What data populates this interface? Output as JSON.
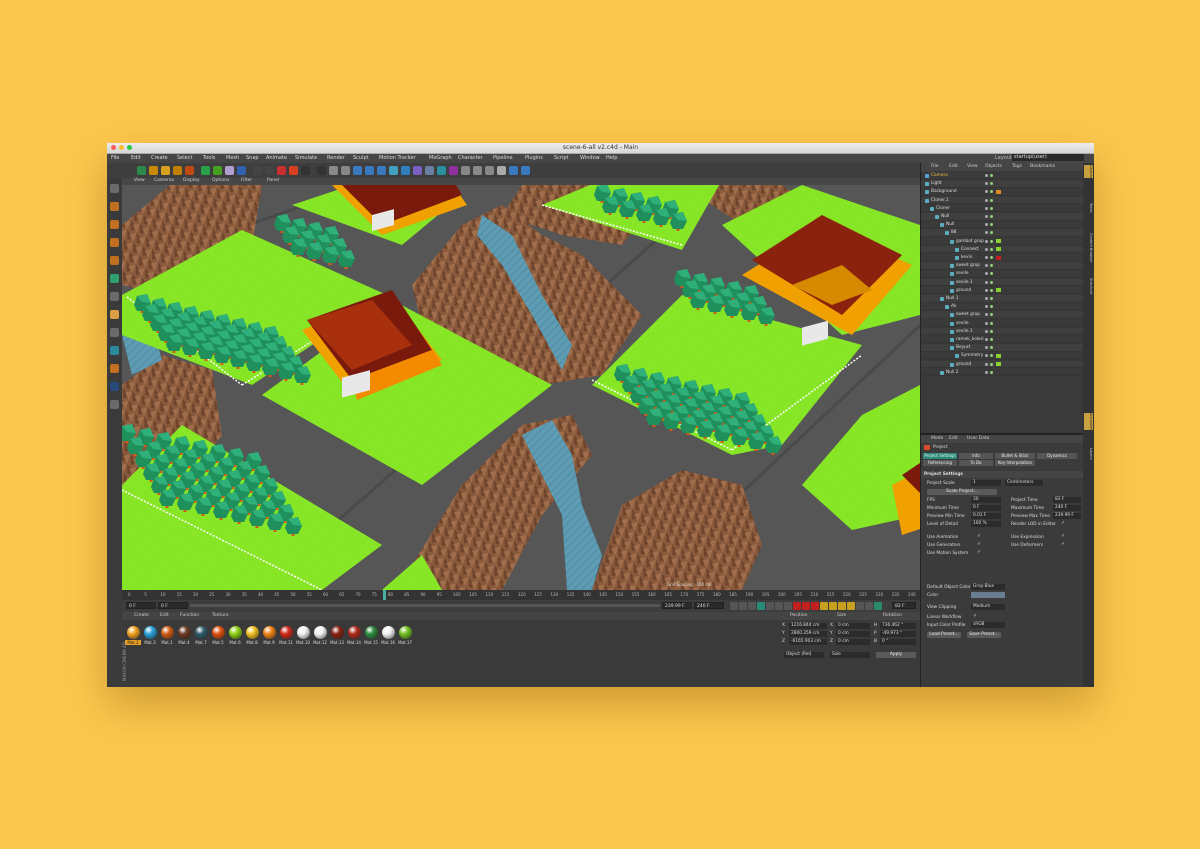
{
  "window": {
    "title": "scene-6-all v2.c4d - Main"
  },
  "menu": [
    "File",
    "Edit",
    "Create",
    "Select",
    "Tools",
    "Mesh",
    "Snap",
    "Animate",
    "Simulate",
    "Render",
    "Sculpt",
    "Motion Tracker",
    "MoGraph",
    "Character",
    "Pipeline",
    "Plugins",
    "Script",
    "Window",
    "Help"
  ],
  "layout": {
    "label": "Layout:",
    "value": "startup(user)"
  },
  "viewport": {
    "menu": [
      "View",
      "Cameras",
      "Display",
      "Options",
      "Filter",
      "Panel"
    ],
    "grid_spacing": "Grid Spacing : 100 cm",
    "perspective_label": "Perspective"
  },
  "timeline": {
    "ticks": [
      "0",
      "5",
      "10",
      "15",
      "20",
      "25",
      "30",
      "35",
      "40",
      "45",
      "50",
      "55",
      "60",
      "65",
      "70",
      "75",
      "80",
      "85",
      "90",
      "95",
      "100",
      "105",
      "110",
      "115",
      "120",
      "125",
      "130",
      "135",
      "140",
      "145",
      "150",
      "155",
      "160",
      "165",
      "170",
      "175",
      "180",
      "185",
      "190",
      "195",
      "200",
      "205",
      "210",
      "215",
      "220",
      "225",
      "230",
      "235",
      "240"
    ],
    "current_frame": "82 F"
  },
  "transport": {
    "start": "0 F",
    "field2": "0 F",
    "end_field": "239.99 F",
    "max": "240 F"
  },
  "materials": {
    "menu": [
      "Create",
      "Edit",
      "Function",
      "Texture"
    ],
    "items": [
      {
        "label": "Mat.2",
        "color": "#f0a020"
      },
      {
        "label": "Mat.3",
        "color": "#2aa0d8"
      },
      {
        "label": "Mat.1",
        "color": "#d05a10"
      },
      {
        "label": "Mat.4",
        "color": "#6b3a20"
      },
      {
        "label": "Mat.7",
        "color": "#2f5a6a"
      },
      {
        "label": "Mat.5",
        "color": "#e05010"
      },
      {
        "label": "Mat.6",
        "color": "#8ad010"
      },
      {
        "label": "Mat.8",
        "color": "#f0c020"
      },
      {
        "label": "Mat.9",
        "color": "#f08010"
      },
      {
        "label": "Mat.11",
        "color": "#d02818"
      },
      {
        "label": "Mat.10",
        "color": "#f0f0f0"
      },
      {
        "label": "Mat.12",
        "color": "#f4f4f4"
      },
      {
        "label": "Mat.13",
        "color": "#8a2010"
      },
      {
        "label": "Mat.14",
        "color": "#b02a18"
      },
      {
        "label": "Mat.15",
        "color": "#2a8a3a"
      },
      {
        "label": "Mat.16",
        "color": "#f0f0f0"
      },
      {
        "label": "Mat.17",
        "color": "#70c020"
      }
    ]
  },
  "coords": {
    "headers": [
      "Position",
      "Size",
      "Rotation"
    ],
    "rows": [
      {
        "axis": "X",
        "pos": "1216.844 cm",
        "size_axis": "X",
        "size": "0 cm",
        "rot_axis": "H",
        "rot": "736.462 °"
      },
      {
        "axis": "Y",
        "pos": "2800.359 cm",
        "size_axis": "Y",
        "size": "0 cm",
        "rot_axis": "P",
        "rot": "-49.973 °"
      },
      {
        "axis": "Z",
        "pos": "-6165.903 cm",
        "size_axis": "Z",
        "size": "0 cm",
        "rot_axis": "B",
        "rot": "0 °"
      }
    ],
    "mode_object": "Object (Rel)",
    "mode_size": "Size",
    "apply": "Apply"
  },
  "objects": {
    "menu": [
      "File",
      "Edit",
      "View",
      "Objects",
      "Tags",
      "Bookmarks"
    ],
    "tree": [
      {
        "name": "Camera",
        "indent": 0,
        "color": "#e9c23c"
      },
      {
        "name": "Light",
        "indent": 0,
        "color": "#dddddd"
      },
      {
        "name": "Background",
        "indent": 0,
        "color": "#dddddd"
      },
      {
        "name": "Cloner.1",
        "indent": 0,
        "color": "#dddddd"
      },
      {
        "name": "Cloner",
        "indent": 1,
        "color": "#dddddd"
      },
      {
        "name": "Null",
        "indent": 2,
        "color": "#dddddd"
      },
      {
        "name": "Null",
        "indent": 3,
        "color": "#dddddd"
      },
      {
        "name": "88",
        "indent": 4,
        "color": "#dddddd"
      },
      {
        "name": "gambot grup",
        "indent": 5,
        "color": "#dddddd"
      },
      {
        "name": "Connect",
        "indent": 6,
        "color": "#dddddd"
      },
      {
        "name": "kevin",
        "indent": 6,
        "color": "#dddddd"
      },
      {
        "name": "sweet grup",
        "indent": 5,
        "color": "#dddddd"
      },
      {
        "name": "sevile",
        "indent": 5,
        "color": "#dddddd"
      },
      {
        "name": "sevile.1",
        "indent": 5,
        "color": "#dddddd"
      },
      {
        "name": "ground",
        "indent": 5,
        "color": "#dddddd"
      },
      {
        "name": "Null.1",
        "indent": 3,
        "color": "#dddddd"
      },
      {
        "name": "Ak",
        "indent": 4,
        "color": "#dddddd"
      },
      {
        "name": "sweet grup",
        "indent": 5,
        "color": "#dddddd"
      },
      {
        "name": "sevile",
        "indent": 5,
        "color": "#dddddd"
      },
      {
        "name": "sevile.1",
        "indent": 5,
        "color": "#dddddd"
      },
      {
        "name": "ramek_koleri",
        "indent": 5,
        "color": "#dddddd"
      },
      {
        "name": "Beyurt",
        "indent": 5,
        "color": "#dddddd"
      },
      {
        "name": "Symmetry",
        "indent": 6,
        "color": "#dddddd"
      },
      {
        "name": "ground",
        "indent": 5,
        "color": "#dddddd"
      },
      {
        "name": "Null.2",
        "indent": 3,
        "color": "#dddddd"
      }
    ]
  },
  "attributes": {
    "menu": [
      "Mode",
      "Edit",
      "User Data"
    ],
    "title": "Project",
    "tabs": [
      "Project Settings",
      "Info",
      "Bullet & Stick",
      "Dynamics",
      "Referencing",
      "To Do",
      "Key Interpolation"
    ],
    "section": "Project Settings",
    "project_scale_label": "Project Scale",
    "project_scale_value": "1",
    "project_scale_unit": "Centimeters",
    "scale_button": "Scale Project...",
    "left_fields": [
      {
        "label": "FPS",
        "value": "30"
      },
      {
        "label": "Minimum Time",
        "value": "0 F"
      },
      {
        "label": "Preview Min Time",
        "value": "0.01 F"
      },
      {
        "label": "Level of Detail",
        "value": "100 %"
      }
    ],
    "right_fields": [
      {
        "label": "Project Time",
        "value": "82 F"
      },
      {
        "label": "Maximum Time",
        "value": "240 F"
      },
      {
        "label": "Preview Max Time",
        "value": "239.99 F"
      },
      {
        "label": "Render LOD in Editor",
        "value": ""
      }
    ],
    "checks_left": [
      "Use Animation",
      "Use Generators",
      "Use Motion System"
    ],
    "checks_right": [
      "Use Expression",
      "Use Deformers"
    ],
    "default_color_label": "Default Object Color",
    "default_color_value": "Gray-Blue",
    "color_label": "Color",
    "view_clipping_label": "View Clipping",
    "view_clipping_value": "Medium",
    "linear_workflow_label": "Linear Workflow",
    "input_profile_label": "Input Color Profile",
    "input_profile_value": "sRGB",
    "load_preset": "Load Preset...",
    "save_preset": "Save Preset..."
  },
  "side_tabs": [
    "Objects",
    "Takes",
    "Content Browser",
    "Structure",
    "Attributes",
    "Layers"
  ],
  "brand": "MAXON CINEMA 4D"
}
